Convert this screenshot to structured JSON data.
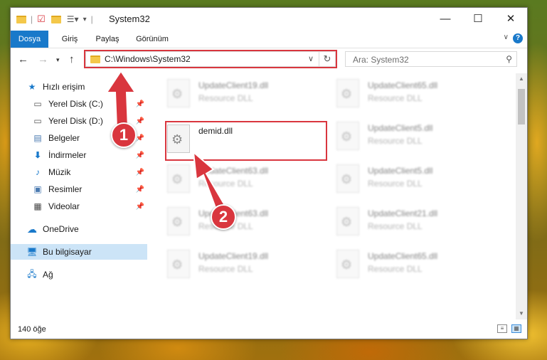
{
  "window": {
    "title": "System32"
  },
  "ribbon": {
    "tabs": [
      "Dosya",
      "Giriş",
      "Paylaş",
      "Görünüm"
    ]
  },
  "address": {
    "path": "C:\\Windows\\System32"
  },
  "search": {
    "placeholder": "Ara: System32"
  },
  "sidebar": {
    "items": [
      {
        "label": "Hızlı erişim",
        "icon": "star-icon",
        "pinned": false
      },
      {
        "label": "Yerel Disk (C:)",
        "icon": "drive-icon",
        "pinned": true
      },
      {
        "label": "Yerel Disk (D:)",
        "icon": "drive-icon",
        "pinned": true
      },
      {
        "label": "Belgeler",
        "icon": "documents-icon",
        "pinned": true
      },
      {
        "label": "İndirmeler",
        "icon": "download-icon",
        "pinned": true
      },
      {
        "label": "Müzik",
        "icon": "music-icon",
        "pinned": true
      },
      {
        "label": "Resimler",
        "icon": "pictures-icon",
        "pinned": true
      },
      {
        "label": "Videolar",
        "icon": "video-icon",
        "pinned": true
      },
      {
        "label": "OneDrive",
        "icon": "cloud-icon",
        "pinned": false
      },
      {
        "label": "Bu bilgisayar",
        "icon": "computer-icon",
        "pinned": false,
        "selected": true
      },
      {
        "label": "Ağ",
        "icon": "network-icon",
        "pinned": false
      }
    ]
  },
  "files": {
    "highlighted": {
      "name": "demid.dll",
      "type": ""
    },
    "left_column": [
      {
        "name": "UpdateClient19.dll",
        "type": "Resource DLL"
      },
      {
        "name": "UpdateClient63.dll",
        "type": "Resource DLL"
      },
      {
        "name": "UpdateClient63.dll",
        "type": "Resource DLL"
      },
      {
        "name": "UpdateClient19.dll",
        "type": "Resource DLL"
      }
    ],
    "right_column": [
      {
        "name": "UpdateClient65.dll",
        "type": "Resource DLL"
      },
      {
        "name": "UpdateClient5.dll",
        "type": "Resource DLL"
      },
      {
        "name": "UpdateClient5.dll",
        "type": "Resource DLL"
      },
      {
        "name": "UpdateClient21.dll",
        "type": "Resource DLL"
      },
      {
        "name": "UpdateClient65.dll",
        "type": "Resource DLL"
      }
    ]
  },
  "status": {
    "count": "140 öğe"
  },
  "annotations": {
    "step1": "1",
    "step2": "2"
  },
  "colors": {
    "accent": "#1979ca",
    "highlight": "#d9363e",
    "selected": "#cce4f7"
  }
}
